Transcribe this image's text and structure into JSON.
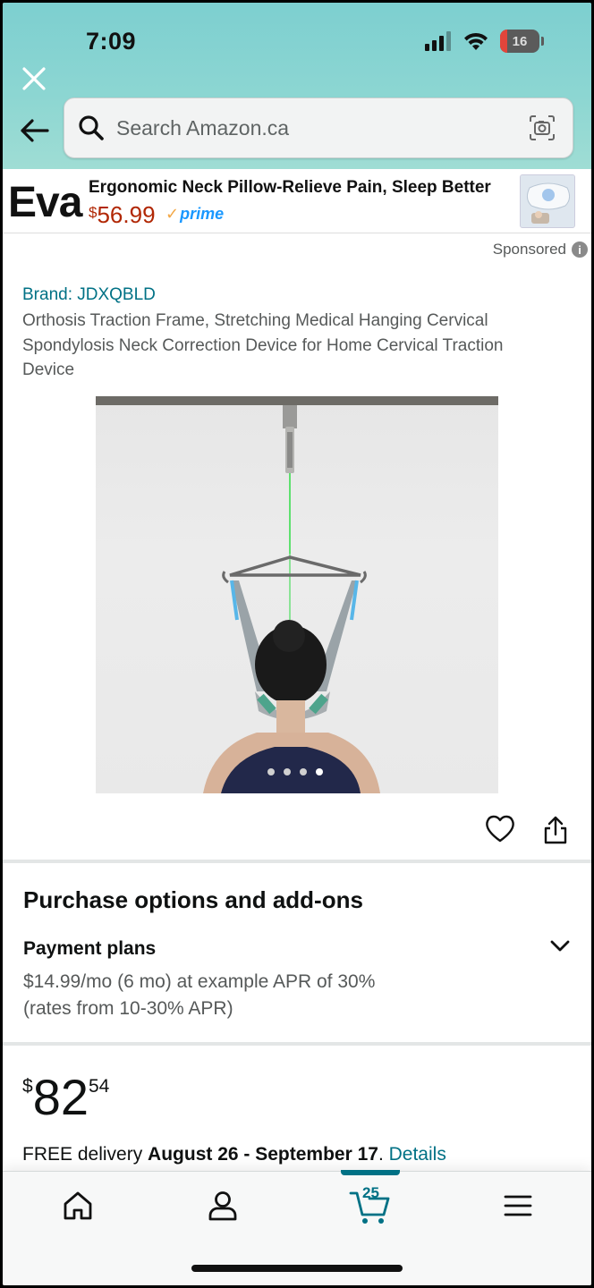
{
  "status_bar": {
    "time": "7:09",
    "battery": "16"
  },
  "header": {
    "search_placeholder": "Search Amazon.ca",
    "bg_color": "#8cd6d2"
  },
  "ad": {
    "brand": "Eva",
    "title": "Ergonomic Neck Pillow-Relieve Pain, Sleep Better",
    "price_symbol": "$",
    "price_value": "56.99",
    "prime_label": "prime",
    "sponsored_label": "Sponsored"
  },
  "product": {
    "brand_link": "Brand: JDXQBLD",
    "title": "Orthosis Traction Frame, Stretching Medical Hanging Cervical Spondylosis Neck Correction Device for Home Cervical Traction Device",
    "image_count": 4,
    "active_image": 1
  },
  "purchase_options": {
    "section_title": "Purchase options and add-ons",
    "payment_plans_title": "Payment plans",
    "plan_line1": "$14.99/mo (6 mo) at example APR of 30%",
    "plan_line2": "(rates from 10-30% APR)"
  },
  "price": {
    "symbol": "$",
    "whole": "82",
    "fraction": "54"
  },
  "delivery": {
    "prefix": "FREE delivery ",
    "dates": "August 26 - September 17",
    "suffix": ". ",
    "details_link": "Details"
  },
  "bottom_nav": {
    "cart_count": "25",
    "accent_color": "#007185"
  }
}
